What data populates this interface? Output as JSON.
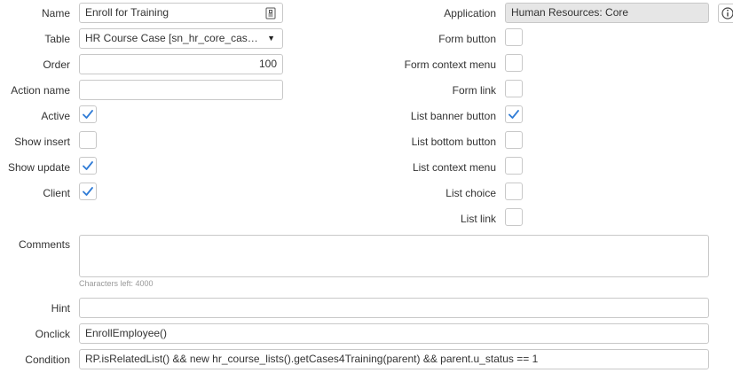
{
  "form": {
    "name": {
      "label": "Name",
      "value": "Enroll for Training"
    },
    "table": {
      "label": "Table",
      "value": "HR Course Case [sn_hr_core_cas…"
    },
    "order": {
      "label": "Order",
      "value": "100"
    },
    "action_name": {
      "label": "Action name",
      "value": ""
    },
    "active": {
      "label": "Active",
      "checked": true
    },
    "show_insert": {
      "label": "Show insert",
      "checked": false
    },
    "show_update": {
      "label": "Show update",
      "checked": true
    },
    "client": {
      "label": "Client",
      "checked": true
    },
    "application": {
      "label": "Application",
      "value": "Human Resources: Core"
    },
    "form_button": {
      "label": "Form button",
      "checked": false
    },
    "form_context_menu": {
      "label": "Form context menu",
      "checked": false
    },
    "form_link": {
      "label": "Form link",
      "checked": false
    },
    "list_banner_button": {
      "label": "List banner button",
      "checked": true
    },
    "list_bottom_button": {
      "label": "List bottom button",
      "checked": false
    },
    "list_context_menu": {
      "label": "List context menu",
      "checked": false
    },
    "list_choice": {
      "label": "List choice",
      "checked": false
    },
    "list_link": {
      "label": "List link",
      "checked": false
    },
    "comments": {
      "label": "Comments",
      "value": "",
      "chars_left": "Characters left: 4000"
    },
    "hint": {
      "label": "Hint",
      "value": ""
    },
    "onclick": {
      "label": "Onclick",
      "value": "EnrollEmployee()"
    },
    "condition": {
      "label": "Condition",
      "value": "RP.isRelatedList() && new hr_course_lists().getCases4Training(parent) && parent.u_status == 1"
    }
  },
  "colors": {
    "check": "#2f7bd6",
    "border": "#c8c8c8",
    "readonly_bg": "#e6e6e6"
  },
  "icons": {
    "name_suffix": "document-icon",
    "table_dropdown": "chevron-down-icon",
    "app_info": "info-icon",
    "checkmark": "checkmark-icon"
  }
}
